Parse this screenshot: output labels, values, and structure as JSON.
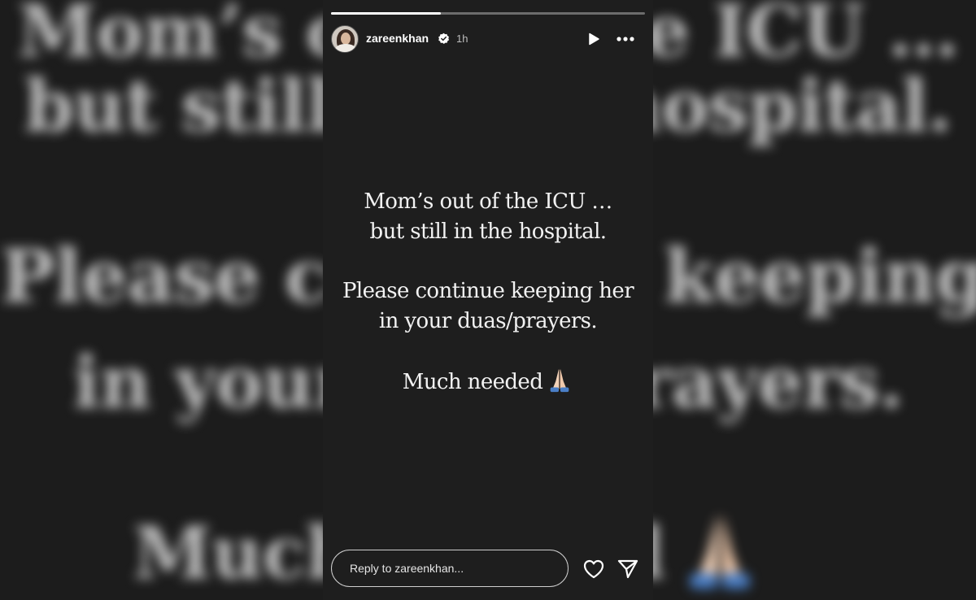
{
  "story": {
    "username": "zareenkhan",
    "time_ago": "1h",
    "progress": 0.35,
    "lines": [
      "Mom’s out of the ICU …",
      "but still in the hospital.",
      "Please continue keeping her",
      "in your duas/prayers.",
      "Much needed"
    ],
    "emoji": "folded-hands-icon"
  },
  "background_text": {
    "line1": "Mom’s out of the ICU …",
    "line2": "but still in the hospital.",
    "line3": "Please continue keeping her",
    "line4": "in your duas/prayers.",
    "line5": "Much needed"
  },
  "reply": {
    "placeholder": "Reply to zareenkhan..."
  },
  "icons": {
    "play": "play-icon",
    "more": "more-options-icon",
    "like": "heart-icon",
    "share": "send-icon",
    "verified": "verified-badge-icon"
  },
  "colors": {
    "background": "#1c1c1c",
    "panel": "#1e1e1e",
    "text": "#f2f2f2",
    "verified_badge": "#ffffff"
  }
}
